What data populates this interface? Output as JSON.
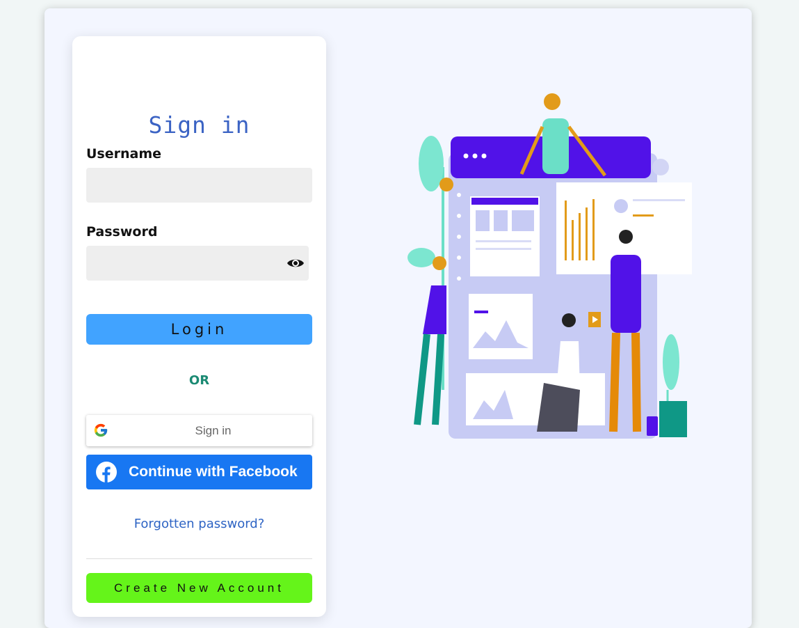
{
  "signin": {
    "title": "Sign in",
    "username_label": "Username",
    "username_value": "",
    "password_label": "Password",
    "password_value": "",
    "login_button": "Login",
    "or_text": "OR",
    "google_button": "Sign in",
    "facebook_button": "Continue with Facebook",
    "forgot_link": "Forgotten password?",
    "create_button": "Create New Account"
  },
  "icons": {
    "password_toggle": "eye-icon",
    "google": "google-logo-icon",
    "facebook": "facebook-logo-icon"
  },
  "colors": {
    "login_button": "#41a3ff",
    "or_text": "#1b8a73",
    "facebook": "#1877f2",
    "create_button": "#65f41a",
    "title": "#3b63c4",
    "link": "#2e64c4"
  }
}
